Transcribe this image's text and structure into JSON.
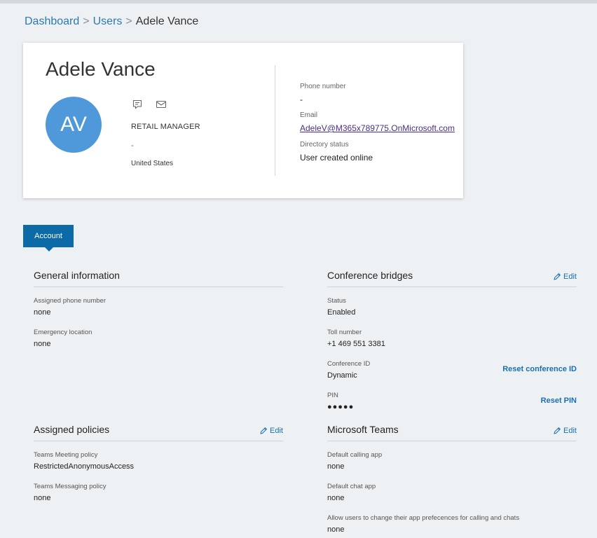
{
  "breadcrumb": {
    "dashboard": "Dashboard",
    "users": "Users",
    "current": "Adele Vance",
    "separator": ">"
  },
  "user": {
    "name": "Adele Vance",
    "initials": "AV",
    "job_title": "RETAIL MANAGER",
    "department": "-",
    "country": "United States",
    "phone_label": "Phone number",
    "phone_value": "-",
    "email_label": "Email",
    "email_value": "AdeleV@M365x789775.OnMicrosoft.com",
    "directory_label": "Directory status",
    "directory_value": "User created online"
  },
  "tabs": {
    "account": "Account"
  },
  "general_information": {
    "title": "General information",
    "assigned_phone_label": "Assigned phone number",
    "assigned_phone_value": "none",
    "emergency_label": "Emergency location",
    "emergency_value": "none"
  },
  "conference_bridges": {
    "title": "Conference bridges",
    "edit": "Edit",
    "status_label": "Status",
    "status_value": "Enabled",
    "toll_label": "Toll number",
    "toll_value": "+1 469 551 3381",
    "conf_id_label": "Conference ID",
    "conf_id_value": "Dynamic",
    "reset_conf_id": "Reset conference ID",
    "pin_label": "PIN",
    "pin_value": "●●●●●",
    "reset_pin": "Reset PIN"
  },
  "assigned_policies": {
    "title": "Assigned policies",
    "edit": "Edit",
    "meeting_label": "Teams Meeting policy",
    "meeting_value": "RestrictedAnonymousAccess",
    "messaging_label": "Teams Messaging policy",
    "messaging_value": "none"
  },
  "microsoft_teams": {
    "title": "Microsoft Teams",
    "edit": "Edit",
    "calling_label": "Default calling app",
    "calling_value": "none",
    "chat_label": "Default chat app",
    "chat_value": "none",
    "allow_label": "Allow users to change their app prefecences for calling and chats",
    "allow_value": "none"
  },
  "icons": {
    "chat": "chat-icon",
    "mail": "mail-icon",
    "edit": "pencil-icon"
  },
  "colors": {
    "accent": "#0c6aa6",
    "link": "#2a7ab0",
    "avatar": "#4f98d9",
    "email_link": "#4b2d88"
  }
}
